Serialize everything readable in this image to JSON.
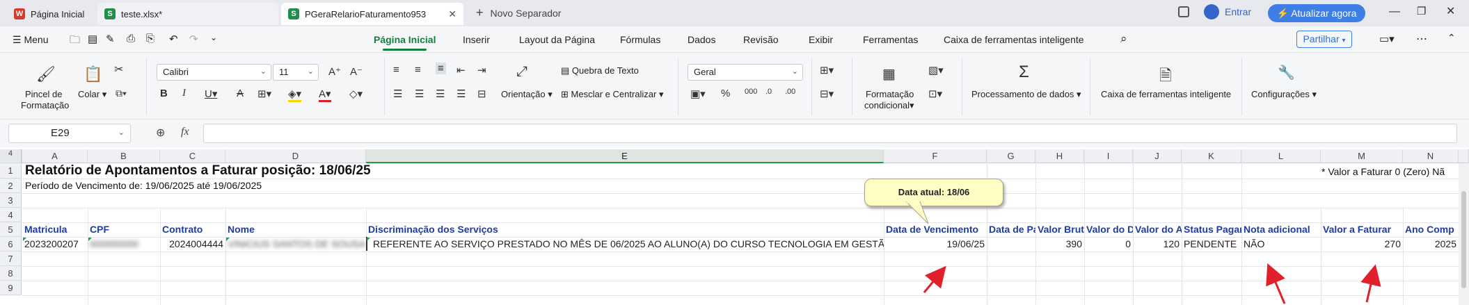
{
  "tabs": [
    {
      "label": "Página Inicial",
      "icon": "wps-logo-icon",
      "color": "#d43b2c",
      "glyph": "W"
    },
    {
      "label": "teste.xlsx*",
      "icon": "sheet-file-icon",
      "color": "#1f8f4a",
      "glyph": "S"
    },
    {
      "label": "PGeraRelarioFaturamento953",
      "icon": "sheet-file-icon",
      "color": "#1f8f4a",
      "glyph": "S",
      "active": true
    }
  ],
  "new_tab_label": "Novo Separador",
  "login_label": "Entrar",
  "update_label": "Atualizar agora",
  "menu_label": "Menu",
  "ribbon_tabs": [
    "Página Inicial",
    "Inserir",
    "Layout da Página",
    "Fórmulas",
    "Dados",
    "Revisão",
    "Exibir",
    "Ferramentas",
    "Caixa de ferramentas inteligente"
  ],
  "share_label": "Partilhar",
  "ribbon": {
    "pincel": "Pincel de",
    "pincel2": "Formatação",
    "colar": "Colar",
    "font": "Calibri",
    "size": "11",
    "quebra": "Quebra de Texto",
    "orientacao": "Orientação",
    "mesclar": "Mesclar e Centralizar",
    "numfmt": "Geral",
    "formatacao": "Formatação",
    "condicional": "condicional",
    "processamento": "Processamento de dados",
    "caixa": "Caixa de ferramentas inteligente",
    "config": "Configurações"
  },
  "namebox": "E29",
  "fx": "fx",
  "columns": [
    "A",
    "B",
    "C",
    "D",
    "E",
    "F",
    "G",
    "H",
    "I",
    "J",
    "K",
    "L",
    "M",
    "N"
  ],
  "rows": [
    "4",
    "1",
    "2",
    "3",
    "4",
    "5",
    "6",
    "7",
    "8",
    "9"
  ],
  "title": "Relatório de Apontamentos a Faturar posição: 18/06/25",
  "periodo": "Período de Vencimento de: 19/06/2025 até 19/06/2025",
  "nota_topo": "* Valor a Faturar 0 (Zero) Nã",
  "headers": [
    "Matricula",
    "CPF",
    "Contrato",
    "Nome",
    "Discriminação dos Serviços",
    "Data de Vencimento",
    "Data de Pa",
    "Valor Brut",
    "Valor do D",
    "Valor do A",
    "Status Pagar",
    "Nota adicional",
    "Valor a Faturar",
    "Ano Comp"
  ],
  "row6": {
    "matricula": "2023200207",
    "cpf": "000000000",
    "contrato": "2024004444",
    "nome": "VINICIUS SANTOS DE SOUSA",
    "discriminacao": "REFERENTE AO SERVIÇO PRESTADO NO MÊS DE 06/2025 AO ALUNO(A) DO CURSO TECNOLOGIA EM GESTÃO C",
    "vencimento": "19/06/25",
    "valor_bruto": "390",
    "valor_d": "0",
    "valor_a": "120",
    "status": "PENDENTE",
    "nota": "NÃO",
    "valor_faturar": "270",
    "ano": "2025"
  },
  "callout": "Data atual: 18/06",
  "colors": {
    "accent": "#12813d",
    "header_text": "#1f3d99",
    "arrow": "#e0202a",
    "update_btn": "#3d7fe6"
  }
}
